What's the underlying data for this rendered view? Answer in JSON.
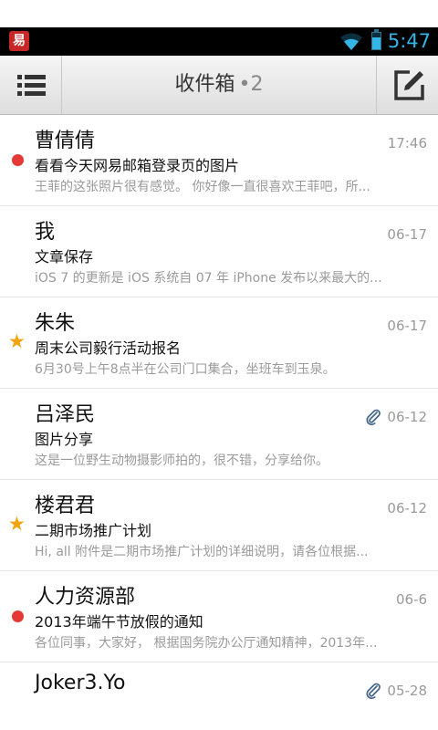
{
  "status_bar": {
    "app_icon_glyph": "易",
    "time": "5:47",
    "icons": [
      "wifi-icon",
      "battery-icon"
    ],
    "battery_level_fraction": 0.75,
    "accent_color": "#33b5e5"
  },
  "header": {
    "title": "收件箱",
    "unread_count": "•2",
    "icons": [
      "menu-icon",
      "compose-icon"
    ]
  },
  "colors": {
    "unread": "#e53935",
    "star": "#f0a30a"
  },
  "messages": [
    {
      "sender": "曹倩倩",
      "date": "17:46",
      "subject": "看看今天网易邮箱登录页的图片",
      "preview": "王菲的这张照片很有感觉。 你好像一直很喜欢王菲吧，所...",
      "marker": "unread",
      "attachment": false
    },
    {
      "sender": "我",
      "date": "06-17",
      "subject": "文章保存",
      "preview": "iOS 7 的更新是 iOS 系统自 07 年 iPhone 发布以来最大的...",
      "marker": "none",
      "attachment": false
    },
    {
      "sender": "朱朱",
      "date": "06-17",
      "subject": "周末公司毅行活动报名",
      "preview": "6月30号上午8点半在公司门口集合，坐班车到玉泉。",
      "marker": "star",
      "attachment": false
    },
    {
      "sender": "吕泽民",
      "date": "06-12",
      "subject": "图片分享",
      "preview": "这是一位野生动物摄影师拍的，很不错，分享给你。",
      "marker": "none",
      "attachment": true
    },
    {
      "sender": "楼君君",
      "date": "06-12",
      "subject": "二期市场推广计划",
      "preview": "Hi, all 附件是二期市场推广计划的详细说明，请各位根据...",
      "marker": "star",
      "attachment": false
    },
    {
      "sender": "人力资源部",
      "date": "06-6",
      "subject": "2013年端午节放假的通知",
      "preview": "各位同事，大家好， 根据国务院办公厅通知精神，2013年...",
      "marker": "unread",
      "attachment": false
    },
    {
      "sender": "Joker3.Yo",
      "date": "05-28",
      "subject": "",
      "preview": "",
      "marker": "none",
      "attachment": true
    }
  ]
}
